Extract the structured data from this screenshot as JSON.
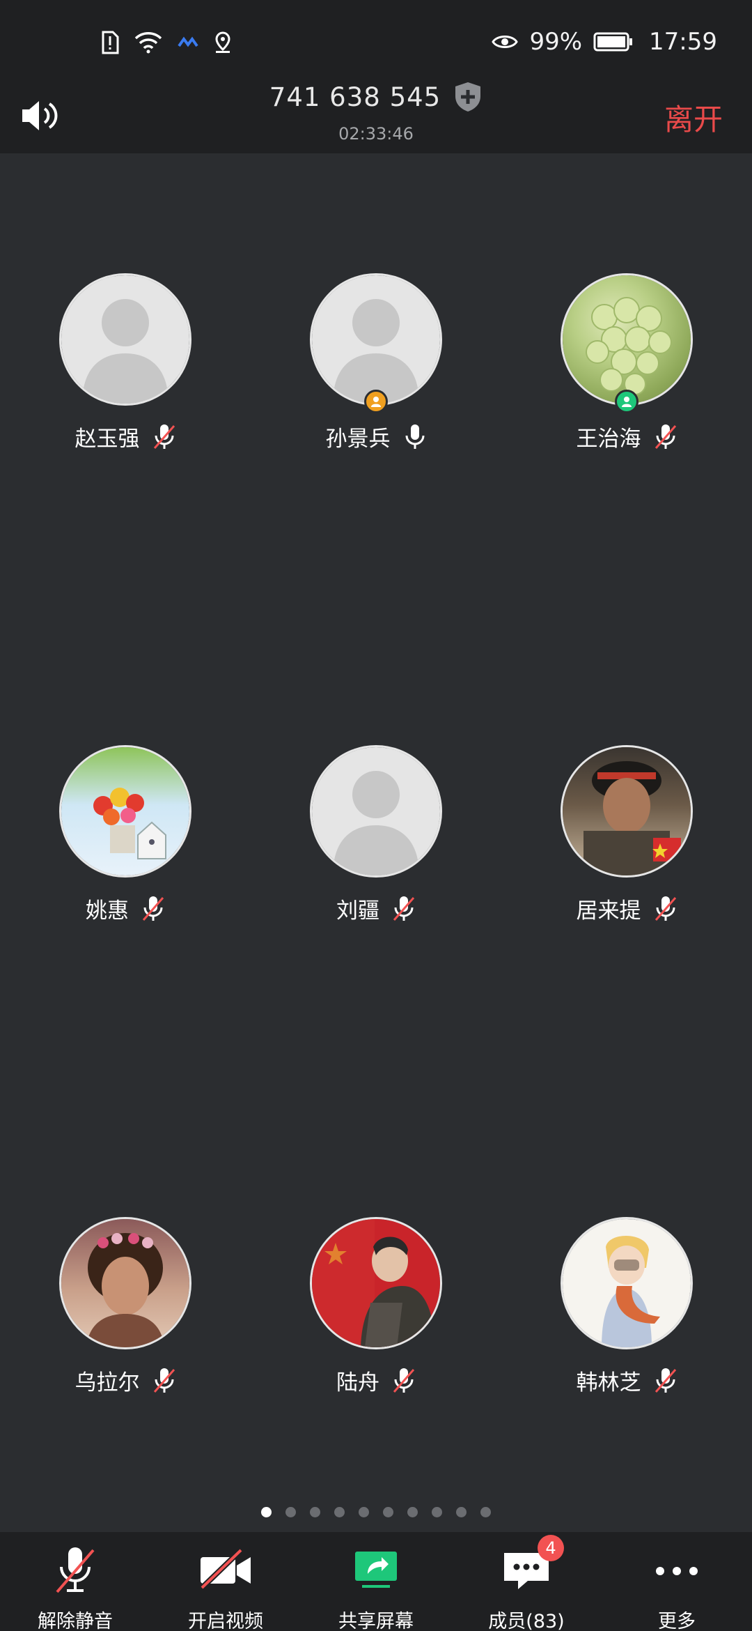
{
  "status_bar": {
    "battery": "99%",
    "time": "17:59",
    "icons": [
      "sim-alert-icon",
      "wifi-icon",
      "data-sync-icon",
      "location-icon",
      "eye-icon",
      "battery-icon"
    ]
  },
  "header": {
    "meeting_id": "741 638 545",
    "timer": "02:33:46",
    "leave_label": "离开",
    "leave_color": "#e94a4a"
  },
  "participants": [
    {
      "name": "赵玉强",
      "muted": true,
      "avatar": "default"
    },
    {
      "name": "孙景兵",
      "muted": false,
      "avatar": "default",
      "badge": "host",
      "badge_color": "#f0a020"
    },
    {
      "name": "王治海",
      "muted": true,
      "avatar": "grapes",
      "badge": "cohost",
      "badge_color": "#1ec77a"
    },
    {
      "name": "姚惠",
      "muted": true,
      "avatar": "flowers"
    },
    {
      "name": "刘疆",
      "muted": true,
      "avatar": "default"
    },
    {
      "name": "居来提",
      "muted": true,
      "avatar": "portrait-boy"
    },
    {
      "name": "乌拉尔",
      "muted": true,
      "avatar": "portrait-woman"
    },
    {
      "name": "陆舟",
      "muted": true,
      "avatar": "flag-man"
    },
    {
      "name": "韩林芝",
      "muted": true,
      "avatar": "illustration"
    }
  ],
  "pagination": {
    "total": 10,
    "active": 0
  },
  "toolbar": {
    "unmute_label": "解除静音",
    "video_label": "开启视频",
    "share_label": "共享屏幕",
    "members_label": "成员(83)",
    "members_badge": "4",
    "more_label": "更多",
    "share_color": "#1ec77a"
  }
}
